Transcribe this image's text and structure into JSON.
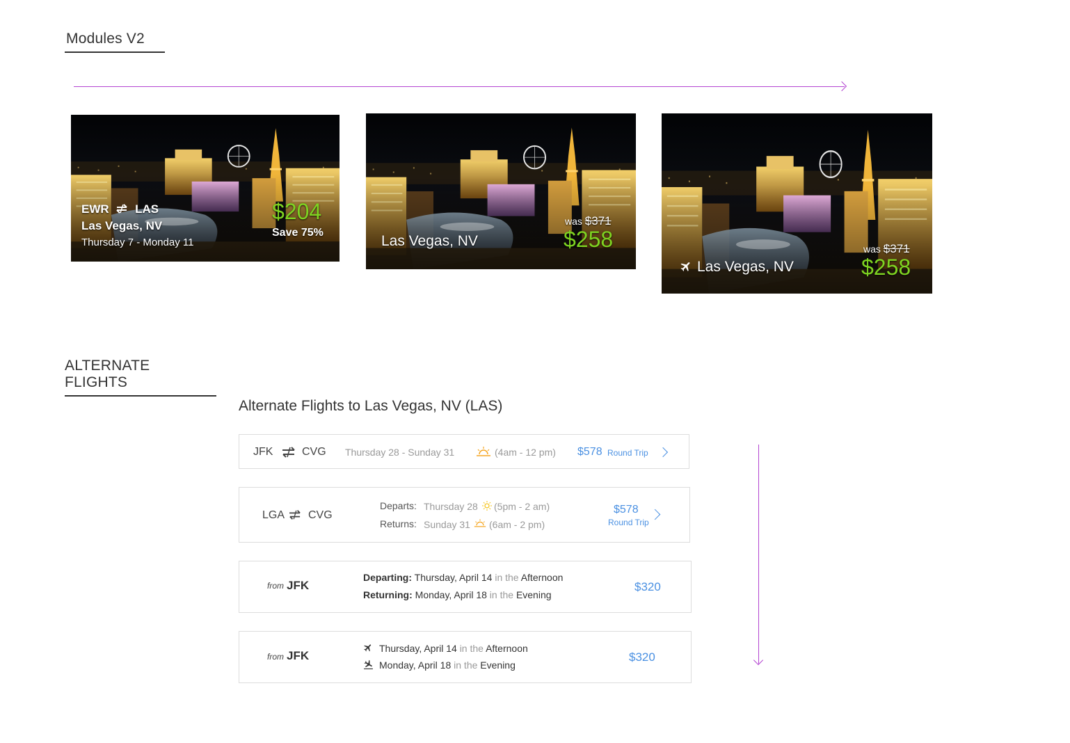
{
  "sections": {
    "modules_title": "Modules V2",
    "alternate_title": "ALTERNATE FLIGHTS"
  },
  "colors": {
    "accent_arrow": "#b344d1",
    "price_green": "#7ed321",
    "price_blue": "#4a90e2"
  },
  "cards": {
    "card1": {
      "origin": "EWR",
      "destination": "LAS",
      "city": "Las Vegas, NV",
      "dates": "Thursday 7 - Monday 11",
      "price": "$204",
      "savings": "Save 75%",
      "route_icon": "roundtrip-arrows-icon"
    },
    "card2": {
      "city": "Las Vegas, NV",
      "was_label": "was",
      "was_price": "$371",
      "price": "$258"
    },
    "card3": {
      "city": "Las Vegas, NV",
      "was_label": "was",
      "was_price": "$371",
      "price": "$258",
      "icon": "airplane-icon"
    }
  },
  "alternate": {
    "heading": "Alternate Flights to Las Vegas, NV (LAS)",
    "row1": {
      "origin": "JFK",
      "destination": "CVG",
      "dates": "Thursday 28 - Sunday 31",
      "time_icon": "sunrise-icon",
      "time": "(4am - 12 pm)",
      "price": "$578",
      "trip": "Round Trip"
    },
    "row2": {
      "origin": "LGA",
      "destination": "CVG",
      "departs_label": "Departs:",
      "departs_day": "Thursday 28",
      "departs_icon": "sun-icon",
      "departs_time": "(5pm - 2 am)",
      "returns_label": "Returns:",
      "returns_day": "Sunday 31",
      "returns_icon": "sunrise-icon",
      "returns_time": "(6am - 2 pm)",
      "price": "$578",
      "trip": "Round Trip"
    },
    "row3": {
      "from_label": "from",
      "origin": "JFK",
      "departing_label": "Departing:",
      "departing_date": "Thursday, April 14",
      "in_the_1": "in the",
      "departing_period": "Afternoon",
      "returning_label": "Returning:",
      "returning_date": "Monday, April 18",
      "in_the_2": "in the",
      "returning_period": "Evening",
      "price": "$320"
    },
    "row4": {
      "from_label": "from",
      "origin": "JFK",
      "depart_icon": "takeoff-icon",
      "depart_date": "Thursday, April 14",
      "in_the_1": "in the",
      "depart_period": "Afternoon",
      "return_icon": "landing-icon",
      "return_date": "Monday, April 18",
      "in_the_2": "in the",
      "return_period": "Evening",
      "price": "$320"
    }
  }
}
